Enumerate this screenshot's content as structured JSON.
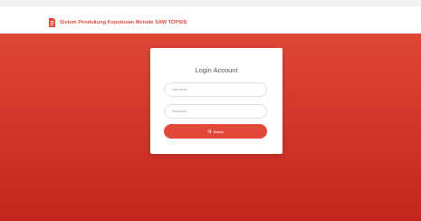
{
  "app": {
    "title": "Sistem Pendukung Keputusan Metode SAW TOPSIS",
    "brand_icon": "doc-icon"
  },
  "login": {
    "title": "Login Account",
    "username_placeholder": "Username",
    "password_placeholder": "Password",
    "button_label": "Masuk",
    "button_icon": "login-icon"
  },
  "colors": {
    "accent": "#e2483a",
    "hero_top": "#de4637",
    "hero_bottom": "#c3261d"
  }
}
